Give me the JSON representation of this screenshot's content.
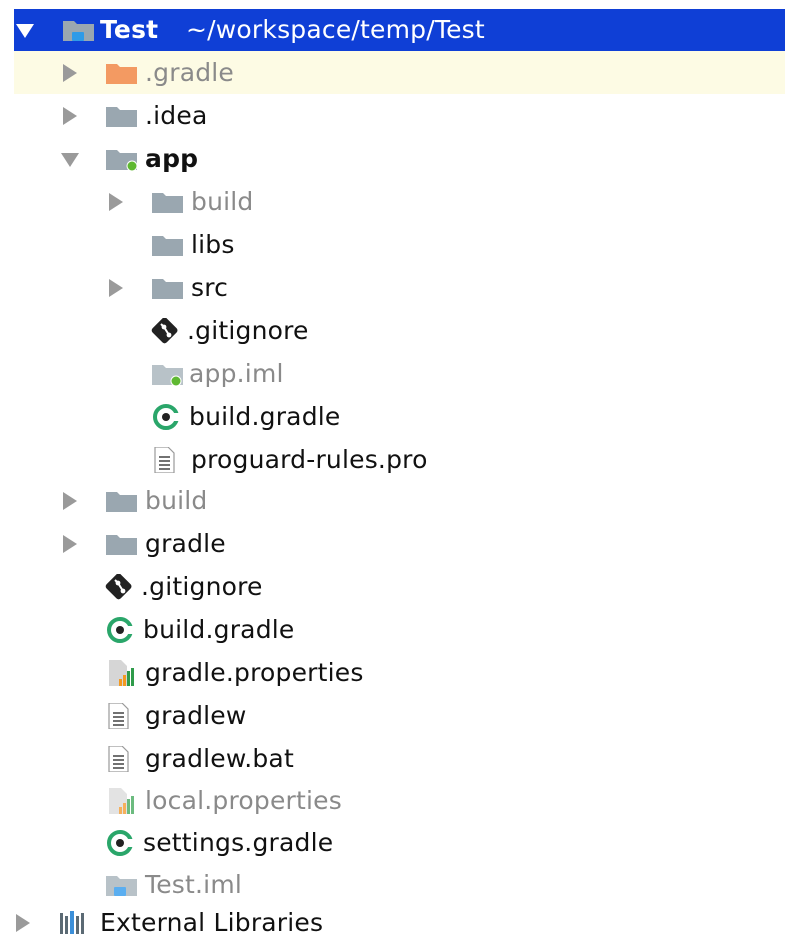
{
  "project": {
    "name": "Test",
    "path": "~/workspace/temp/Test"
  },
  "tree": {
    "gradle_dir": ".gradle",
    "idea_dir": ".idea",
    "app_dir": "app",
    "app_build_dir": "build",
    "app_libs_dir": "libs",
    "app_src_dir": "src",
    "app_gitignore": ".gitignore",
    "app_iml": "app.iml",
    "app_build_gradle": "build.gradle",
    "app_proguard": "proguard-rules.pro",
    "build_dir": "build",
    "gradle_wrapper_dir": "gradle",
    "root_gitignore": ".gitignore",
    "root_build_gradle": "build.gradle",
    "gradle_properties": "gradle.properties",
    "gradlew": "gradlew",
    "gradlew_bat": "gradlew.bat",
    "local_properties": "local.properties",
    "settings_gradle": "settings.gradle",
    "test_iml": "Test.iml",
    "external_libraries": "External Libraries"
  },
  "icons": {
    "folder": "folder-icon",
    "excluded_folder": "excluded-folder-icon",
    "module_folder": "module-folder-icon",
    "git_file": "git-icon",
    "gradle_file": "gradle-icon",
    "text_file": "text-file-icon",
    "properties_file": "properties-icon",
    "libraries": "libraries-icon"
  },
  "colors": {
    "selection": "#0f3fd6",
    "hover": "#fdfbe4",
    "folder": "#9aa7b0",
    "excluded_folder": "#f39a62",
    "module_dot": "#5fb832",
    "gradle": "#2aa66a",
    "dim_text": "#8a8a8a"
  }
}
